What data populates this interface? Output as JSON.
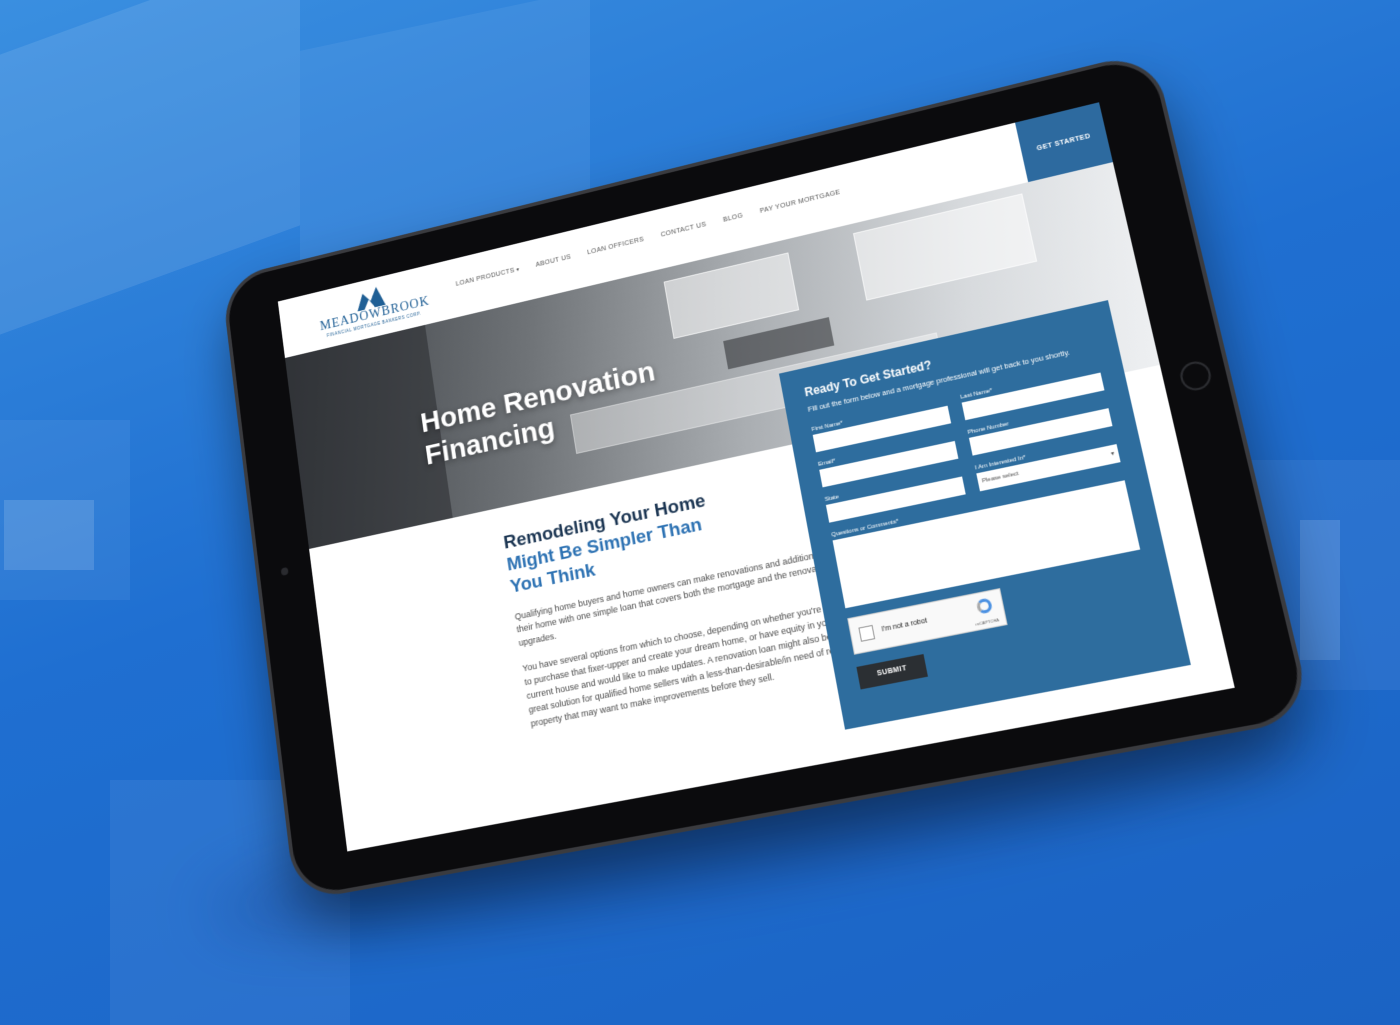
{
  "site": {
    "logo_text": "MEADOWBROOK",
    "logo_tagline": "FINANCIAL MORTGAGE BANKERS CORP.",
    "nav": [
      {
        "label": "LOAN PRODUCTS",
        "has_dropdown": true
      },
      {
        "label": "ABOUT US"
      },
      {
        "label": "LOAN OFFICERS"
      },
      {
        "label": "CONTACT US"
      },
      {
        "label": "BLOG"
      },
      {
        "label": "PAY YOUR MORTGAGE"
      }
    ],
    "cta_label": "GET STARTED"
  },
  "hero": {
    "line1": "Home Renovation",
    "line2": "Financing"
  },
  "content": {
    "heading_line1": "Remodeling Your Home",
    "heading_line2": "Might Be Simpler Than",
    "heading_line3": "You Think",
    "para1": "Qualifying home buyers and home owners can make renovations and additions to their home with one simple loan that covers both the mortgage and the renovation upgrades.",
    "para2": "You have several options from which to choose, depending on whether you're looking to purchase that fixer-upper and create your dream home, or have equity in your current house and would like to make updates. A renovation loan might also be a great solution for qualified home sellers with a less-than-desirable/in need of repair property that may want to make improvements before they sell."
  },
  "form": {
    "title": "Ready To Get Started?",
    "subtitle": "Fill out the form below and a mortgage professional will get back to you shortly.",
    "first_name_label": "First Name*",
    "last_name_label": "Last Name*",
    "email_label": "Email*",
    "phone_label": "Phone Number",
    "state_label": "State",
    "interest_label": "I Am Interested In*",
    "interest_selected": "Please select",
    "comments_label": "Questions or Comments*",
    "captcha_label": "I'm not a robot",
    "captcha_brand": "reCAPTCHA",
    "submit_label": "SUBMIT"
  },
  "colors": {
    "background": "#2272d3",
    "brand_blue": "#2e6d9e",
    "heading_dark": "#1b3552",
    "heading_accent": "#2d72b3"
  }
}
